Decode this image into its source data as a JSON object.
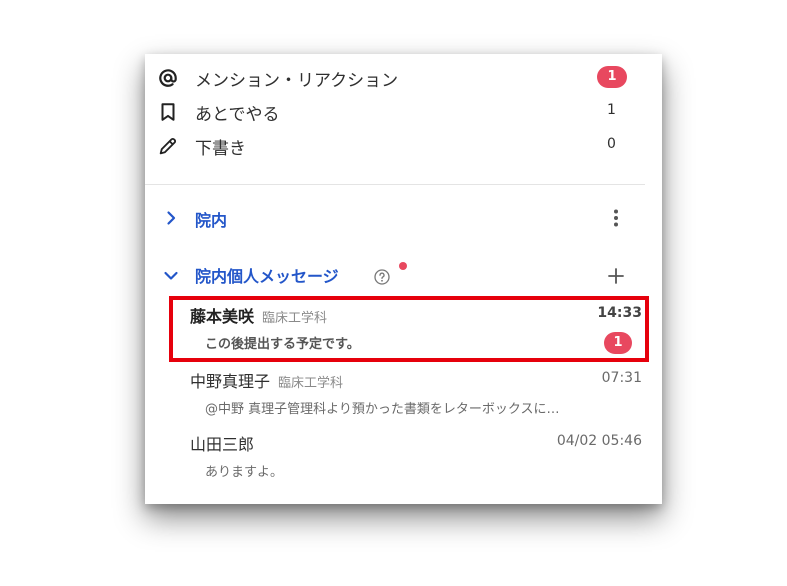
{
  "menu": [
    {
      "label": "メンション・リアクション",
      "badge": "1",
      "icon": "at-icon"
    },
    {
      "label": "あとでやる",
      "count": "1",
      "icon": "bookmark-icon"
    },
    {
      "label": "下書き",
      "count": "0",
      "icon": "pencil-icon"
    }
  ],
  "sections": {
    "innai": {
      "title": "院内"
    },
    "dm": {
      "title": "院内個人メッセージ"
    }
  },
  "conversations": [
    {
      "name": "藤本美咲",
      "dept": "臨床工学科",
      "time": "14:33",
      "preview": "この後提出する予定です。",
      "badge": "1"
    },
    {
      "name": "中野真理子",
      "dept": "臨床工学科",
      "time": "07:31",
      "preview": "@中野 真理子管理科より預かった書類をレターボックスに…"
    },
    {
      "name": "山田三郎",
      "dept": "",
      "time": "04/02 05:46",
      "preview": "ありますよ。"
    }
  ],
  "colors": {
    "accent": "#2356c9",
    "badge": "#e8485f",
    "highlight": "#e6000c"
  }
}
